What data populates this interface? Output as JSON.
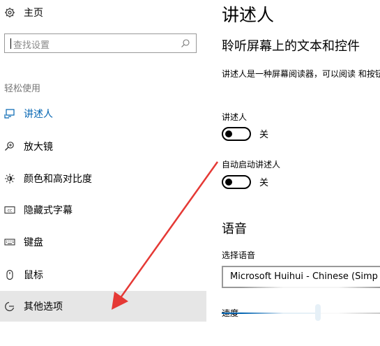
{
  "sidebar": {
    "home_label": "主页",
    "search": {
      "placeholder": "查找设置"
    },
    "section_title": "轻松使用",
    "items": [
      {
        "label": "讲述人",
        "icon": "narrator-icon"
      },
      {
        "label": "放大镜",
        "icon": "magnifier-icon"
      },
      {
        "label": "颜色和高对比度",
        "icon": "contrast-icon"
      },
      {
        "label": "隐藏式字幕",
        "icon": "closed-caption-icon"
      },
      {
        "label": "键盘",
        "icon": "keyboard-icon"
      },
      {
        "label": "鼠标",
        "icon": "mouse-icon"
      },
      {
        "label": "其他选项",
        "icon": "other-options-icon"
      }
    ]
  },
  "main": {
    "title": "讲述人",
    "subtitle": "聆听屏幕上的文本和控件",
    "description": "讲述人是一种屏幕阅读器，可以阅读 和按钮。",
    "narrator": {
      "label": "讲述人",
      "state": "关"
    },
    "autostart": {
      "label": "自动启动讲述人",
      "state": "关"
    },
    "voice_section": "语音",
    "choose_voice_label": "选择语音",
    "voice_value": "Microsoft Huihui - Chinese (Simp",
    "speed_label": "速度",
    "speed_value": 0.58
  },
  "colors": {
    "accent": "#0063b1",
    "hover_bg": "#e6e6e6",
    "arrow": "#e53935"
  }
}
